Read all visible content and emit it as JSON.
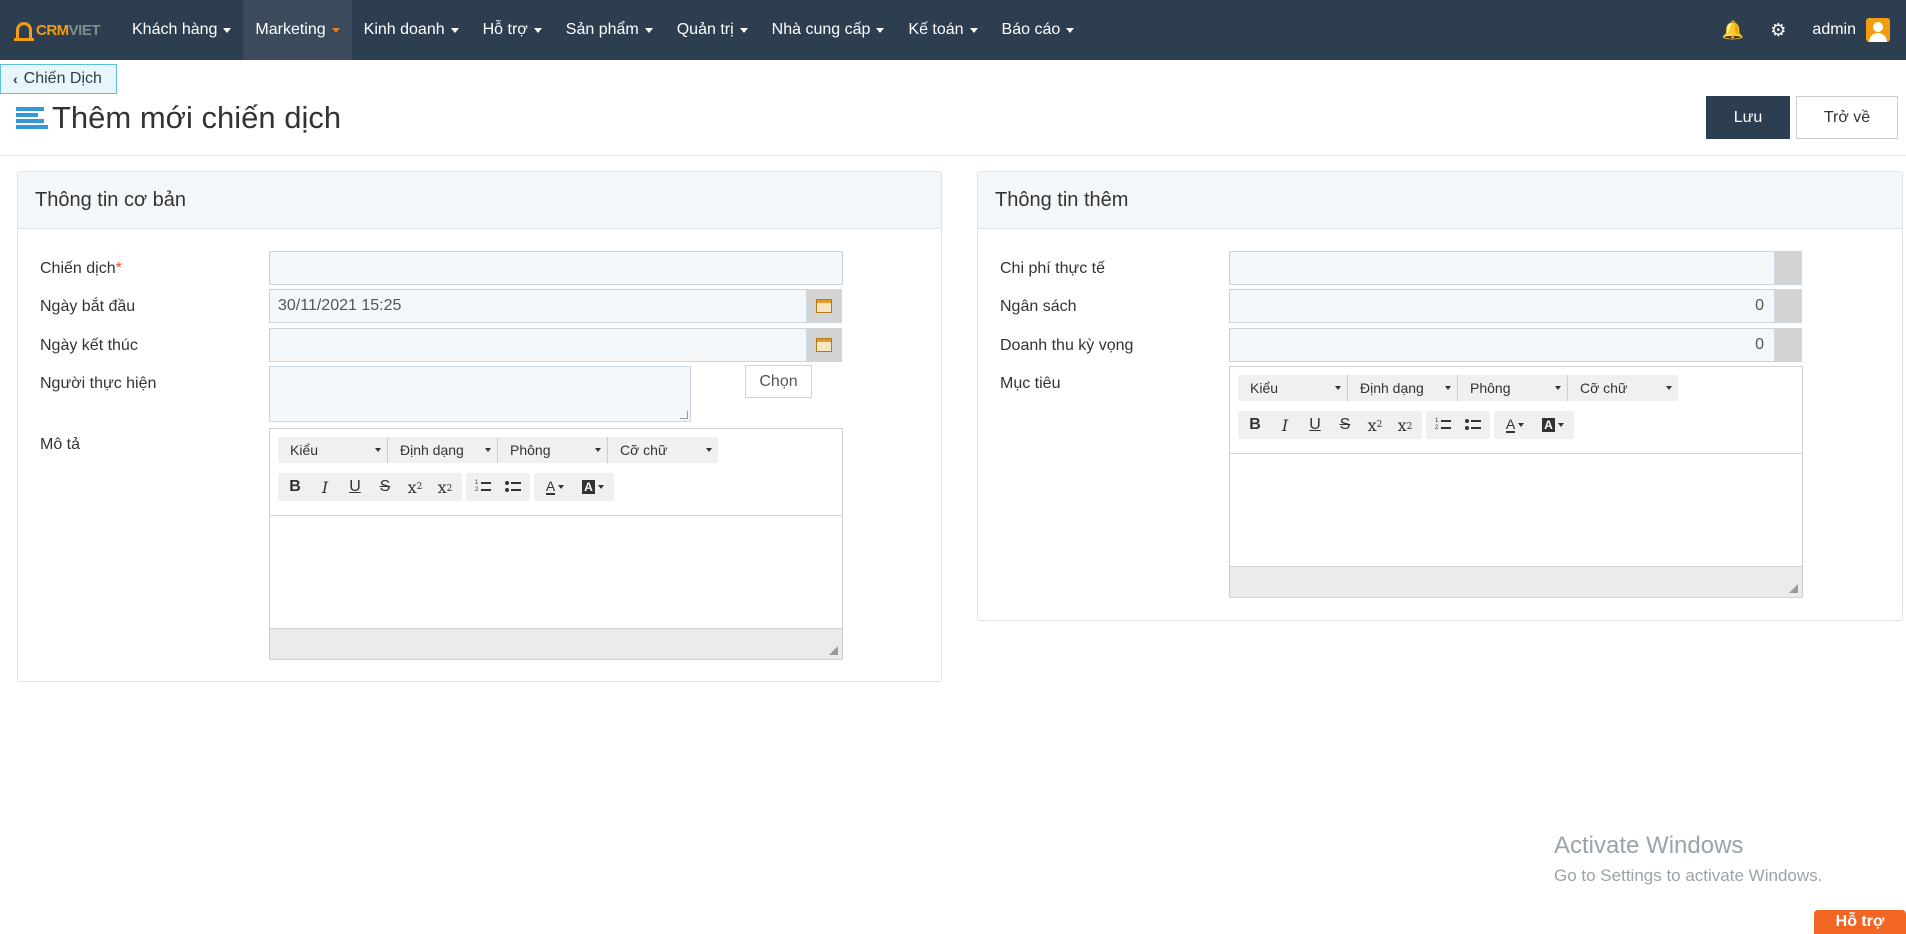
{
  "logo": {
    "crm": "CRM",
    "viet": "VIET"
  },
  "nav": {
    "items": [
      {
        "label": "Khách hàng"
      },
      {
        "label": "Marketing",
        "active": true
      },
      {
        "label": "Kinh doanh"
      },
      {
        "label": "Hỗ trợ"
      },
      {
        "label": "Sản phẩm"
      },
      {
        "label": "Quản trị"
      },
      {
        "label": "Nhà cung cấp"
      },
      {
        "label": "Kế toán"
      },
      {
        "label": "Báo cáo"
      }
    ],
    "user": "admin",
    "bell_icon": "🔔",
    "gear_icon": "⚙"
  },
  "breadcrumb": {
    "chevron": "‹",
    "label": "Chiến Dịch"
  },
  "page": {
    "title": "Thêm mới chiến dịch"
  },
  "actions": {
    "save": "Lưu",
    "back": "Trở về"
  },
  "basic": {
    "title": "Thông tin cơ bản",
    "campaign_label": "Chiến dịch",
    "required_mark": "*",
    "campaign_value": "",
    "start_label": "Ngày bắt đầu",
    "start_value": "30/11/2021 15:25",
    "end_label": "Ngày kết thúc",
    "end_value": "",
    "assignee_label": "Người thực hiện",
    "choose_button": "Chọn",
    "desc_label": "Mô tả"
  },
  "extra": {
    "title": "Thông tin thêm",
    "actual_cost_label": "Chi phí thực tế",
    "actual_cost_value": "",
    "budget_label": "Ngân sách",
    "budget_value": "0",
    "expected_revenue_label": "Doanh thu kỳ vọng",
    "expected_revenue_value": "0",
    "goal_label": "Mục tiêu"
  },
  "editor": {
    "style": "Kiểu",
    "format": "Định dạng",
    "font": "Phông",
    "size": "Cỡ chữ",
    "bold": "B",
    "italic": "I",
    "underline": "U",
    "strike": "S",
    "sub": "x",
    "sup": "x",
    "text_color": "A",
    "bg_color": "A"
  },
  "watermark": {
    "line1": "Activate Windows",
    "line2": "Go to Settings to activate Windows."
  },
  "support": "Hỗ trợ"
}
